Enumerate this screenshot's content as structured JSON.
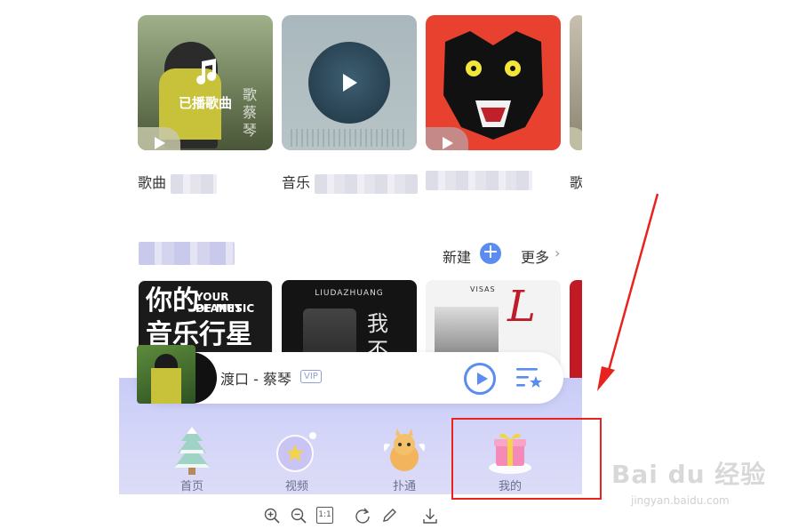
{
  "cards": [
    {
      "title": "歌曲",
      "overlay": "已播歌曲",
      "singer_tag": "歌 蔡琴"
    },
    {
      "title": "音乐"
    },
    {
      "title": ""
    },
    {
      "title": "歌"
    }
  ],
  "section": {
    "new_label": "新建",
    "more_label": "更多",
    "more_chevron": "›"
  },
  "albums": [
    {
      "line1": "你的",
      "line2": "YOUR PLANET",
      "line3": "OF MUSIC",
      "line4": "音乐行星"
    },
    {
      "artist": "LIUDAZHUANG",
      "script": "我不"
    },
    {
      "brand": "VISAS",
      "script": "L"
    }
  ],
  "player": {
    "song": "渡口 - 蔡琴",
    "badge": "VIP"
  },
  "nav": {
    "items": [
      {
        "label": "首页",
        "icon": "tree-icon"
      },
      {
        "label": "视频",
        "icon": "bubble-star-icon"
      },
      {
        "label": "扑通",
        "icon": "squirrel-icon"
      },
      {
        "label": "我的",
        "icon": "gift-icon"
      }
    ]
  },
  "toolbar": {
    "icons": [
      "zoom-in-icon",
      "zoom-out-icon",
      "actual-size-icon",
      "rotate-icon",
      "edit-icon",
      "download-icon"
    ],
    "actual_size_text": "1:1"
  },
  "watermark": {
    "logo": "Bai du 经验",
    "url": "jingyan.baidu.com"
  },
  "colors": {
    "accent": "#5b8cf0",
    "annotation": "#e8231e",
    "nav_bg": "#cfd2f7"
  }
}
